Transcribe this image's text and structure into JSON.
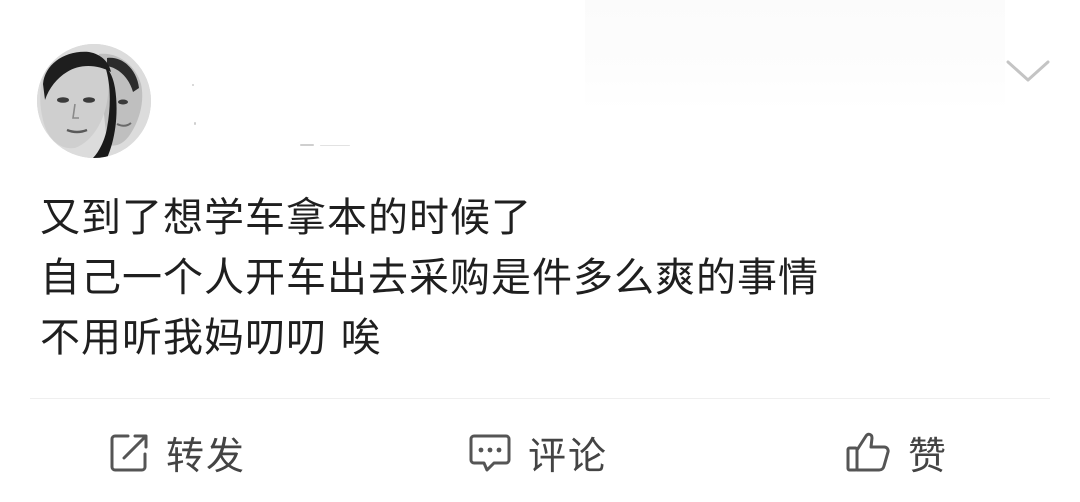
{
  "post": {
    "text_lines": [
      "又到了想学车拿本的时候了",
      "自己一个人开车出去采购是件多么爽的事情",
      "不用听我妈叨叨 唉"
    ]
  },
  "actions": {
    "repost_label": "转发",
    "comment_label": "评论",
    "like_label": "赞"
  },
  "icons": {
    "menu": "chevron-down-icon",
    "repost": "share-icon",
    "comment": "comment-icon",
    "like": "thumbs-up-icon"
  },
  "colors": {
    "text": "#1f1f1f",
    "action_text": "#444444",
    "icon_stroke": "#555555",
    "divider": "#efefef",
    "chevron": "#c4c4c4"
  }
}
